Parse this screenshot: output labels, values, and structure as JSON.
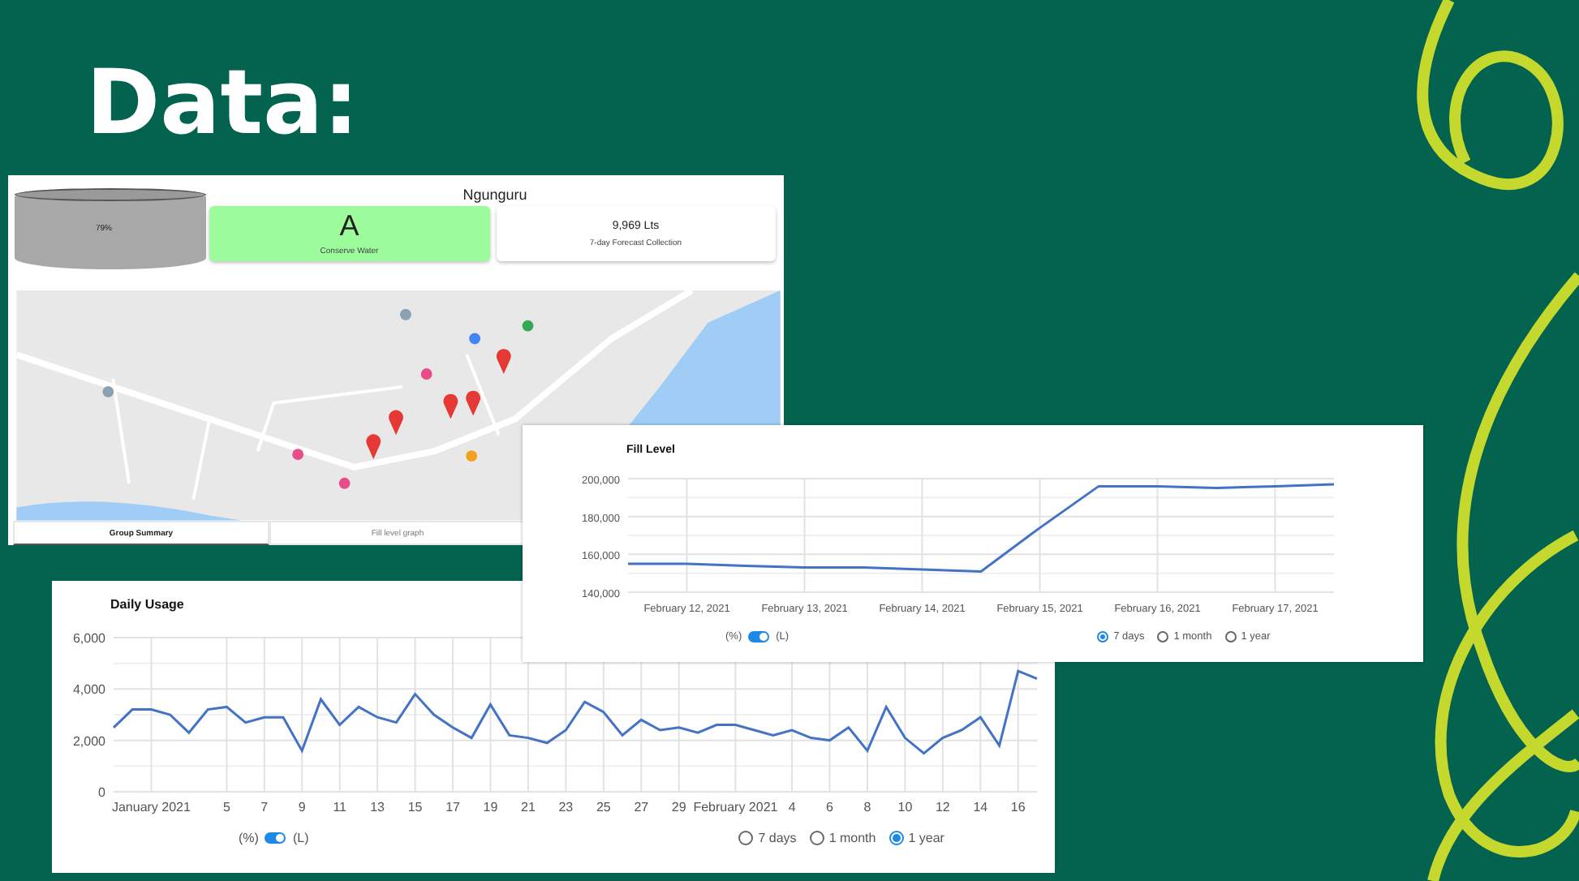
{
  "slide": {
    "title": "Data:"
  },
  "summary_window": {
    "tank": {
      "reading": "79%"
    },
    "site_name": "Ngunguru",
    "cards": [
      {
        "kind": "status",
        "value": "A",
        "caption": "Conserve Water"
      },
      {
        "kind": "stat",
        "value": "9,969 Lts",
        "caption": "7-day Forecast Collection"
      }
    ],
    "tabs": [
      {
        "label": "Group Summary",
        "selected": true
      },
      {
        "label": "Fill level graph",
        "selected": false
      }
    ]
  },
  "fill_level_window": {
    "chart_data": {
      "type": "line",
      "title": "Fill Level",
      "grid": true,
      "categories": [
        null,
        "February 12, 2021",
        null,
        "February 13, 2021",
        null,
        "February 14, 2021",
        null,
        "February 15, 2021",
        null,
        "February 16, 2021",
        null,
        "February 17, 2021",
        null
      ],
      "ylim": [
        140000,
        200000
      ],
      "series": [
        {
          "color": "#4472c4",
          "values": [
            155000,
            155000,
            154000,
            153000,
            153000,
            152000,
            151000,
            174000,
            196000,
            196000,
            195000,
            196000,
            197000
          ]
        }
      ],
      "yticks": [
        {
          "value": 140000,
          "label": "140,000"
        },
        {
          "value": 160000,
          "label": "160,000"
        },
        {
          "value": 180000,
          "label": "180,000"
        },
        {
          "value": 200000,
          "label": "200,000"
        }
      ]
    },
    "unit_toggle": {
      "left": "(%)",
      "right": "(L)",
      "on": true
    },
    "ranges": [
      {
        "label": "7 days",
        "selected": true
      },
      {
        "label": "1 month",
        "selected": false
      },
      {
        "label": "1 year",
        "selected": false
      }
    ]
  },
  "daily_usage_window": {
    "chart_data": {
      "type": "line",
      "title": "Daily Usage",
      "grid": true,
      "categories": [
        null,
        null,
        "January 2021",
        null,
        null,
        null,
        "5",
        null,
        "7",
        null,
        "9",
        null,
        "11",
        null,
        "13",
        null,
        "15",
        null,
        "17",
        null,
        "19",
        null,
        "21",
        null,
        "23",
        null,
        "25",
        null,
        "27",
        null,
        "29",
        null,
        null,
        "February 2021",
        null,
        null,
        "4",
        null,
        "6",
        null,
        "8",
        null,
        "10",
        null,
        "12",
        null,
        "14",
        null,
        "16",
        null
      ],
      "ylim": [
        0,
        6000
      ],
      "series": [
        {
          "color": "#4472c4",
          "values": [
            2500,
            3200,
            3200,
            3000,
            2300,
            3200,
            3300,
            2700,
            2900,
            2900,
            1600,
            3600,
            2600,
            3300,
            2900,
            2700,
            3800,
            3000,
            2500,
            2100,
            3400,
            2200,
            2100,
            1900,
            2400,
            3500,
            3100,
            2200,
            2800,
            2400,
            2500,
            2300,
            2600,
            2600,
            2400,
            2200,
            2400,
            2100,
            2000,
            2500,
            1600,
            3300,
            2100,
            1500,
            2100,
            2400,
            2900,
            1800,
            4700,
            4400
          ]
        }
      ],
      "yticks": [
        {
          "value": 0,
          "label": "0"
        },
        {
          "value": 2000,
          "label": "2,000"
        },
        {
          "value": 4000,
          "label": "4,000"
        },
        {
          "value": 6000,
          "label": "6,000"
        }
      ]
    },
    "unit_toggle": {
      "left": "(%)",
      "right": "(L)",
      "on": true
    },
    "ranges": [
      {
        "label": "7 days",
        "selected": false
      },
      {
        "label": "1 month",
        "selected": false
      },
      {
        "label": "1 year",
        "selected": true
      }
    ]
  }
}
